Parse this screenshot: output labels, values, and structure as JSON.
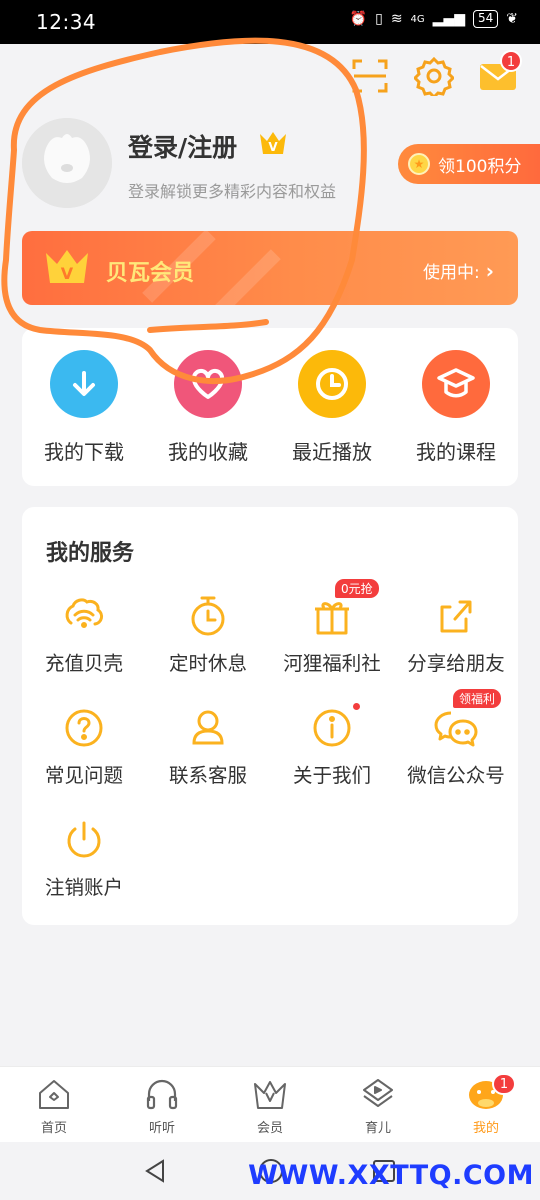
{
  "status_bar": {
    "time": "12:34",
    "network": "4G",
    "battery": "54"
  },
  "header": {
    "mail_badge_count": "1"
  },
  "profile": {
    "title": "登录/注册",
    "crown_letter": "V",
    "subtitle": "登录解锁更多精彩内容和权益"
  },
  "points": {
    "label": "领100积分",
    "coin_letter": "★"
  },
  "vip": {
    "crown_letter": "V",
    "title": "贝瓦会员",
    "status": "使用中:"
  },
  "quick_actions": [
    {
      "label": "我的下载",
      "color": "#3bb9f0",
      "icon": "download-icon"
    },
    {
      "label": "我的收藏",
      "color": "#f0567a",
      "icon": "heart-icon"
    },
    {
      "label": "最近播放",
      "color": "#fcb90a",
      "icon": "clock-icon"
    },
    {
      "label": "我的课程",
      "color": "#ff6a3d",
      "icon": "graduation-cap-icon"
    }
  ],
  "services": {
    "title": "我的服务",
    "items": [
      {
        "label": "充值贝壳",
        "icon": "shell-icon"
      },
      {
        "label": "定时休息",
        "icon": "timer-icon"
      },
      {
        "label": "河狸福利社",
        "icon": "gift-icon",
        "badge": "0元抢"
      },
      {
        "label": "分享给朋友",
        "icon": "share-icon"
      },
      {
        "label": "常见问题",
        "icon": "question-icon"
      },
      {
        "label": "联系客服",
        "icon": "customer-service-icon"
      },
      {
        "label": "关于我们",
        "icon": "info-icon"
      },
      {
        "label": "微信公众号",
        "icon": "wechat-icon",
        "badge": "领福利"
      },
      {
        "label": "注销账户",
        "icon": "power-icon"
      }
    ]
  },
  "bottom_nav": {
    "items": [
      {
        "label": "首页",
        "icon": "home-icon"
      },
      {
        "label": "听听",
        "icon": "headphones-icon"
      },
      {
        "label": "会员",
        "icon": "crown-icon"
      },
      {
        "label": "育儿",
        "icon": "play-book-icon"
      },
      {
        "label": "我的",
        "icon": "profile-mascot-icon",
        "badge": "1",
        "active": true
      }
    ]
  },
  "watermark": "WWW.XXTTQ.COM",
  "colors": {
    "accent": "#ff9a1a",
    "vip_gradient_start": "#ff6e3f",
    "badge_red": "#f33d3d",
    "scribble": "#ff8a3a"
  }
}
